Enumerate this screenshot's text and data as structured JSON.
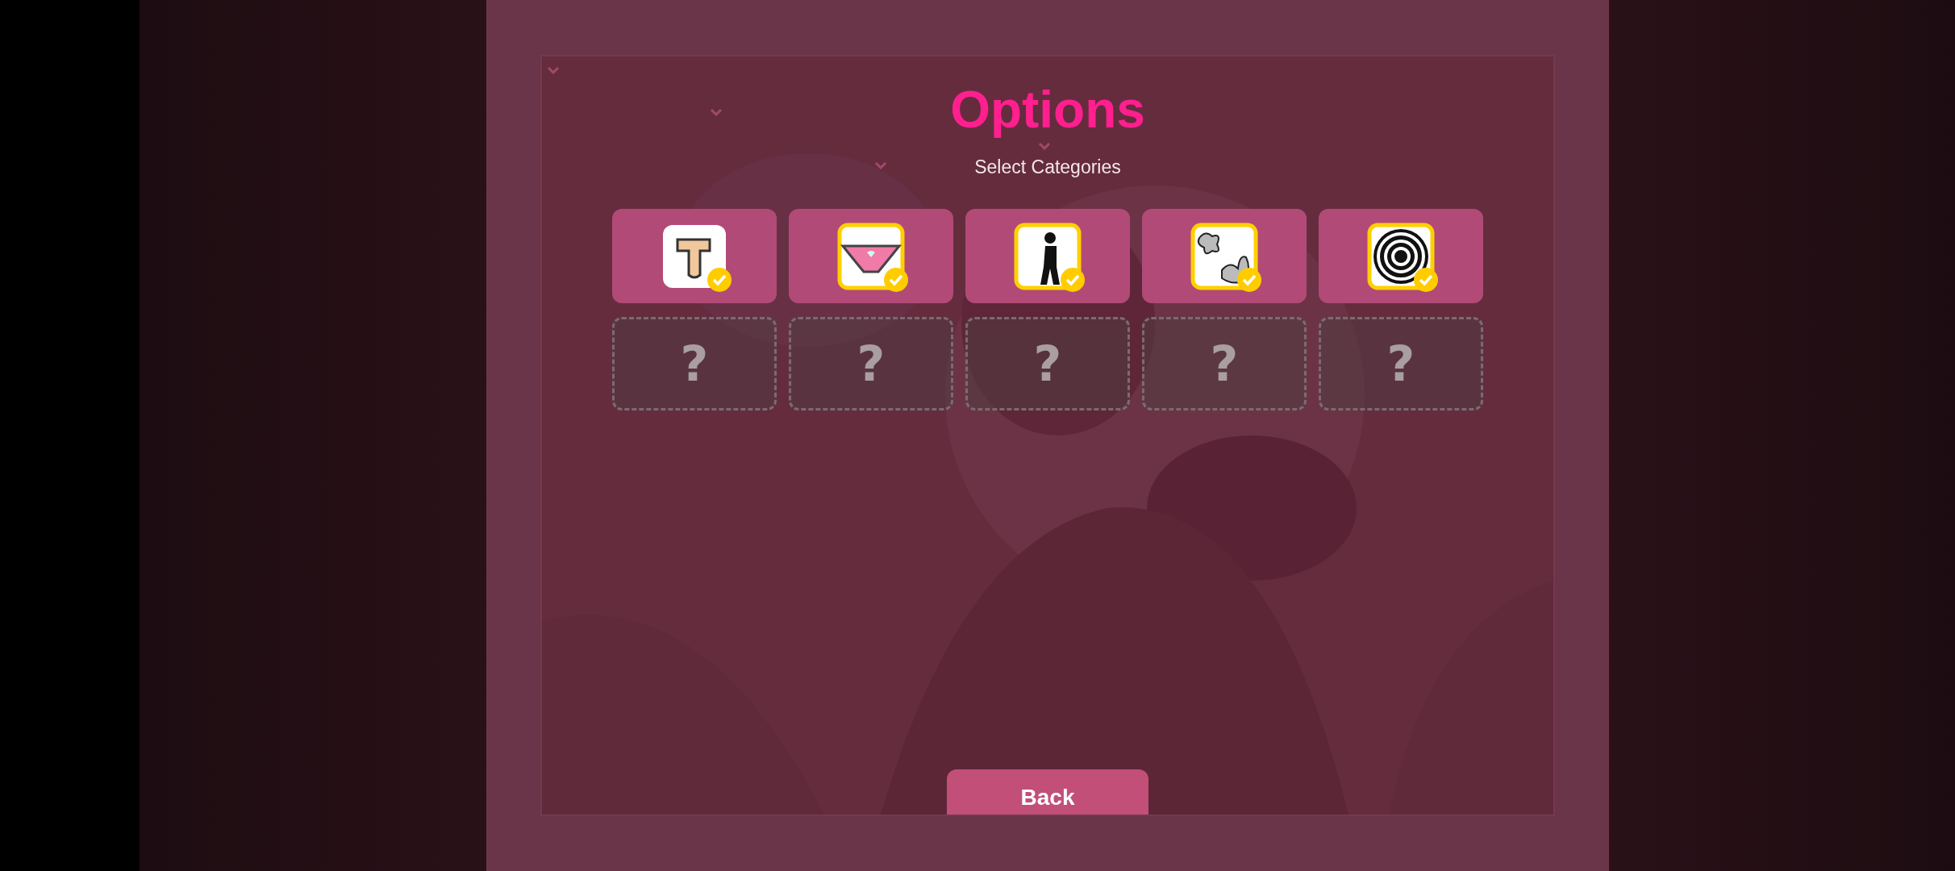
{
  "title": "Options",
  "subtitle": "Select Categories",
  "categories": [
    {
      "kind": "unlocked",
      "checked": true
    },
    {
      "kind": "unlocked",
      "checked": true
    },
    {
      "kind": "unlocked",
      "checked": true
    },
    {
      "kind": "unlocked",
      "checked": true
    },
    {
      "kind": "unlocked",
      "checked": true
    },
    {
      "kind": "locked",
      "label": "?"
    },
    {
      "kind": "locked",
      "label": "?"
    },
    {
      "kind": "locked",
      "label": "?"
    },
    {
      "kind": "locked",
      "label": "?"
    },
    {
      "kind": "locked",
      "label": "?"
    }
  ],
  "back_button": "Back"
}
